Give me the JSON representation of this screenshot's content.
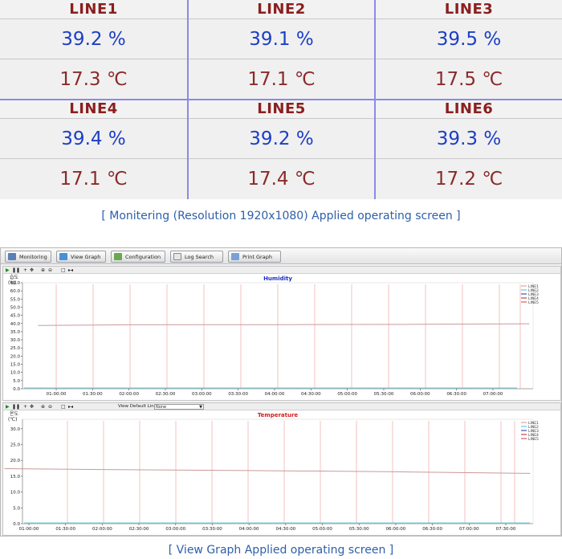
{
  "monitor": {
    "lines": [
      {
        "name": "LINE1",
        "humidity": "39.2 %",
        "temperature": "17.3 ℃"
      },
      {
        "name": "LINE2",
        "humidity": "39.1 %",
        "temperature": "17.1 ℃"
      },
      {
        "name": "LINE3",
        "humidity": "39.5 %",
        "temperature": "17.5 ℃"
      },
      {
        "name": "LINE4",
        "humidity": "39.4 %",
        "temperature": "17.1 ℃"
      },
      {
        "name": "LINE5",
        "humidity": "39.2 %",
        "temperature": "17.4 ℃"
      },
      {
        "name": "LINE6",
        "humidity": "39.3 %",
        "temperature": "17.2 ℃"
      }
    ],
    "caption": "[ Monitering (Resolution 1920x1080) Applied operating screen ]"
  },
  "toolbar": {
    "monitoring": "Monitoring",
    "view_graph": "View Graph",
    "configuration": "Configuration",
    "log_search": "Log Search",
    "print_graph": "Print Graph"
  },
  "humidity_pane": {
    "y_label_top": "습도",
    "y_unit": "(%)",
    "controls": [
      "▶",
      "❚❚",
      "+",
      "✥",
      "🔍",
      "🔍",
      "□",
      "▸|◂"
    ]
  },
  "temperature_pane": {
    "y_label_top": "온도",
    "y_unit": "(℃)",
    "view_default_line_label": "View Default Line",
    "view_default_line_value": "None"
  },
  "colors": {
    "vline": "#f2a7a7",
    "series": "#c99a9a",
    "line2": "#3fbfd1",
    "line3": "#1f2fbf",
    "line4": "#c01c1c",
    "line5": "#d23b3b",
    "line1": "#e48f8f"
  },
  "caption_graph": "[ View Graph Applied operating screen ]",
  "chart_data": [
    {
      "type": "line",
      "title": "Humidity",
      "xlabel": "",
      "ylabel": "(%)",
      "ylim": [
        0,
        65
      ],
      "yticks": [
        "65.0",
        "60.0",
        "55.0",
        "50.0",
        "45.0",
        "40.0",
        "35.0",
        "30.0",
        "25.0",
        "20.0",
        "15.0",
        "10.0",
        "5.0",
        "0.0"
      ],
      "xticks": [
        "01:00:00",
        "01:30:00",
        "02:00:00",
        "02:30:00",
        "03:00:00",
        "03:30:00",
        "04:00:00",
        "04:30:00",
        "05:00:00",
        "05:30:00",
        "06:00:00",
        "06:30:00",
        "07:00:00"
      ],
      "legend": [
        "LINE1",
        "LINE2",
        "LINE3",
        "LINE4",
        "LINE5"
      ],
      "legend_position": "top-right",
      "series": [
        {
          "name": "LINE1",
          "x": [
            "00:45:00",
            "02:00:00",
            "04:00:00",
            "06:00:00",
            "07:30:00"
          ],
          "values": [
            38.8,
            39.2,
            39.3,
            39.5,
            39.8
          ]
        }
      ]
    },
    {
      "type": "line",
      "title": "Temperature",
      "xlabel": "",
      "ylabel": "(℃)",
      "ylim": [
        0,
        33
      ],
      "yticks": [
        "30.0",
        "25.0",
        "20.0",
        "15.0",
        "10.0",
        "5.0",
        "0.0"
      ],
      "xticks": [
        "01:00:00",
        "01:30:00",
        "02:00:00",
        "02:30:00",
        "03:00:00",
        "03:30:00",
        "04:00:00",
        "04:30:00",
        "05:00:00",
        "05:30:00",
        "06:00:00",
        "06:30:00",
        "07:00:00",
        "07:30:00"
      ],
      "legend": [
        "LINE1",
        "LINE2",
        "LINE3",
        "LINE4",
        "LINE5"
      ],
      "legend_position": "top-right",
      "series": [
        {
          "name": "LINE1",
          "x": [
            "00:40:00",
            "02:00:00",
            "04:00:00",
            "06:00:00",
            "07:50:00"
          ],
          "values": [
            17.4,
            17.1,
            16.8,
            16.4,
            15.9
          ]
        }
      ]
    }
  ]
}
